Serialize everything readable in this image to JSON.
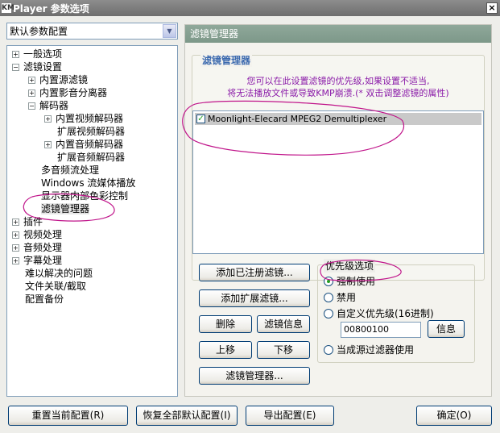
{
  "window": {
    "title": "Player 参数选项",
    "logo_text": "KM",
    "close_glyph": "×"
  },
  "left": {
    "preset_value": "默认参数配置",
    "tree": [
      {
        "label": "一般选项",
        "expander": "+"
      },
      {
        "label": "滤镜设置",
        "expander": "−"
      },
      {
        "label": "内置源滤镜",
        "expander": "+"
      },
      {
        "label": "内置影音分离器",
        "expander": "+"
      },
      {
        "label": "解码器",
        "expander": "−"
      },
      {
        "label": "内置视频解码器",
        "expander": "+"
      },
      {
        "label": "扩展视频解码器",
        "expander": ""
      },
      {
        "label": "内置音频解码器",
        "expander": "+"
      },
      {
        "label": "扩展音频解码器",
        "expander": ""
      },
      {
        "label": "多音频流处理",
        "expander": ""
      },
      {
        "label": "Windows 流媒体播放",
        "expander": ""
      },
      {
        "label": "显示器内部色彩控制",
        "expander": ""
      },
      {
        "label": "滤镜管理器",
        "expander": ""
      },
      {
        "label": "插件",
        "expander": "+"
      },
      {
        "label": "视频处理",
        "expander": "+"
      },
      {
        "label": "音频处理",
        "expander": "+"
      },
      {
        "label": "字幕处理",
        "expander": "+"
      },
      {
        "label": "难以解决的问题",
        "expander": ""
      },
      {
        "label": "文件关联/截取",
        "expander": ""
      },
      {
        "label": "配置备份",
        "expander": ""
      }
    ]
  },
  "right": {
    "header": "滤镜管理器",
    "group_title": "滤镜管理器",
    "note_line1": "您可以在此设置滤镜的优先级,如果设置不适当,",
    "note_line2": "将无法播放文件或导致KMP崩溃.(* 双击调整滤镜的属性)",
    "filters": [
      {
        "name": "Moonlight-Elecard MPEG2 Demultiplexer",
        "checked": true
      }
    ],
    "buttons": {
      "add_registered": "添加已注册滤镜...",
      "add_extended": "添加扩展滤镜...",
      "delete": "删除",
      "filter_info": "滤镜信息",
      "move_up": "上移",
      "move_down": "下移",
      "filter_manager": "滤镜管理器..."
    },
    "priority": {
      "title": "优先级选项",
      "options": [
        "强制使用",
        "禁用",
        "自定义优先级(16进制)",
        "当成源过滤器使用"
      ],
      "selected": 0,
      "hex_value": "00800100",
      "info_button": "信息"
    }
  },
  "bottom": {
    "reset_current": "重置当前配置(R)",
    "restore_defaults": "恢复全部默认配置(I)",
    "export_config": "导出配置(E)",
    "ok": "确定(O)"
  },
  "colors": {
    "annotation": "#c0148a",
    "note_text": "#8a1aa8",
    "group_title": "#3c6aaf"
  }
}
